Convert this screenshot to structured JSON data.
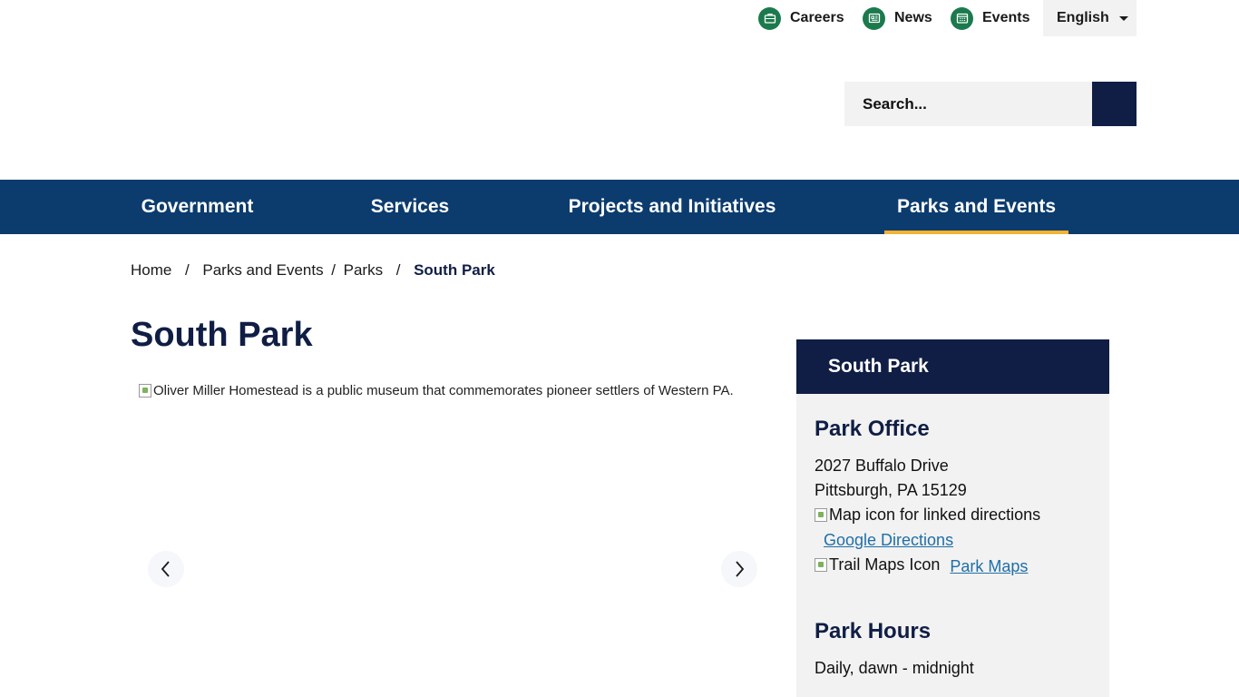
{
  "colors": {
    "navy": "#0c3c6e",
    "dark_navy": "#101e45",
    "green": "#1b7a4d",
    "gold": "#f2b233",
    "link": "#1f6fa8",
    "panel": "#f2f2f2"
  },
  "utility": {
    "links": [
      {
        "label": "Careers",
        "icon": "briefcase-icon"
      },
      {
        "label": "News",
        "icon": "newspaper-icon"
      },
      {
        "label": "Events",
        "icon": "calendar-icon"
      }
    ],
    "language": "English"
  },
  "search": {
    "placeholder": "Search...",
    "button_icon": "search-icon"
  },
  "nav": {
    "items": [
      {
        "label": "Government",
        "active": false
      },
      {
        "label": "Services",
        "active": false
      },
      {
        "label": "Projects and Initiatives",
        "active": false
      },
      {
        "label": "Parks and Events",
        "active": true
      }
    ]
  },
  "breadcrumb": {
    "items": [
      "Home",
      "Parks and Events",
      "Parks"
    ],
    "separator": "/",
    "current": "South Park"
  },
  "page": {
    "title": "South Park"
  },
  "carousel": {
    "image_alt": "Oliver Miller Homestead is a public museum that commemorates pioneer settlers of Western PA.",
    "prev_icon": "chevron-left-icon",
    "next_icon": "chevron-right-icon"
  },
  "sidebar": {
    "header": "South Park",
    "office_heading": "Park Office",
    "address_line1": "2027 Buffalo Drive",
    "address_line2": "Pittsburgh, PA 15129",
    "map_icon_alt": "Map icon for linked directions",
    "directions_link": "Google Directions",
    "trail_icon_alt": "Trail Maps Icon",
    "maps_link": "Park Maps",
    "hours_heading": "Park Hours",
    "hours_text": "Daily, dawn - midnight"
  }
}
